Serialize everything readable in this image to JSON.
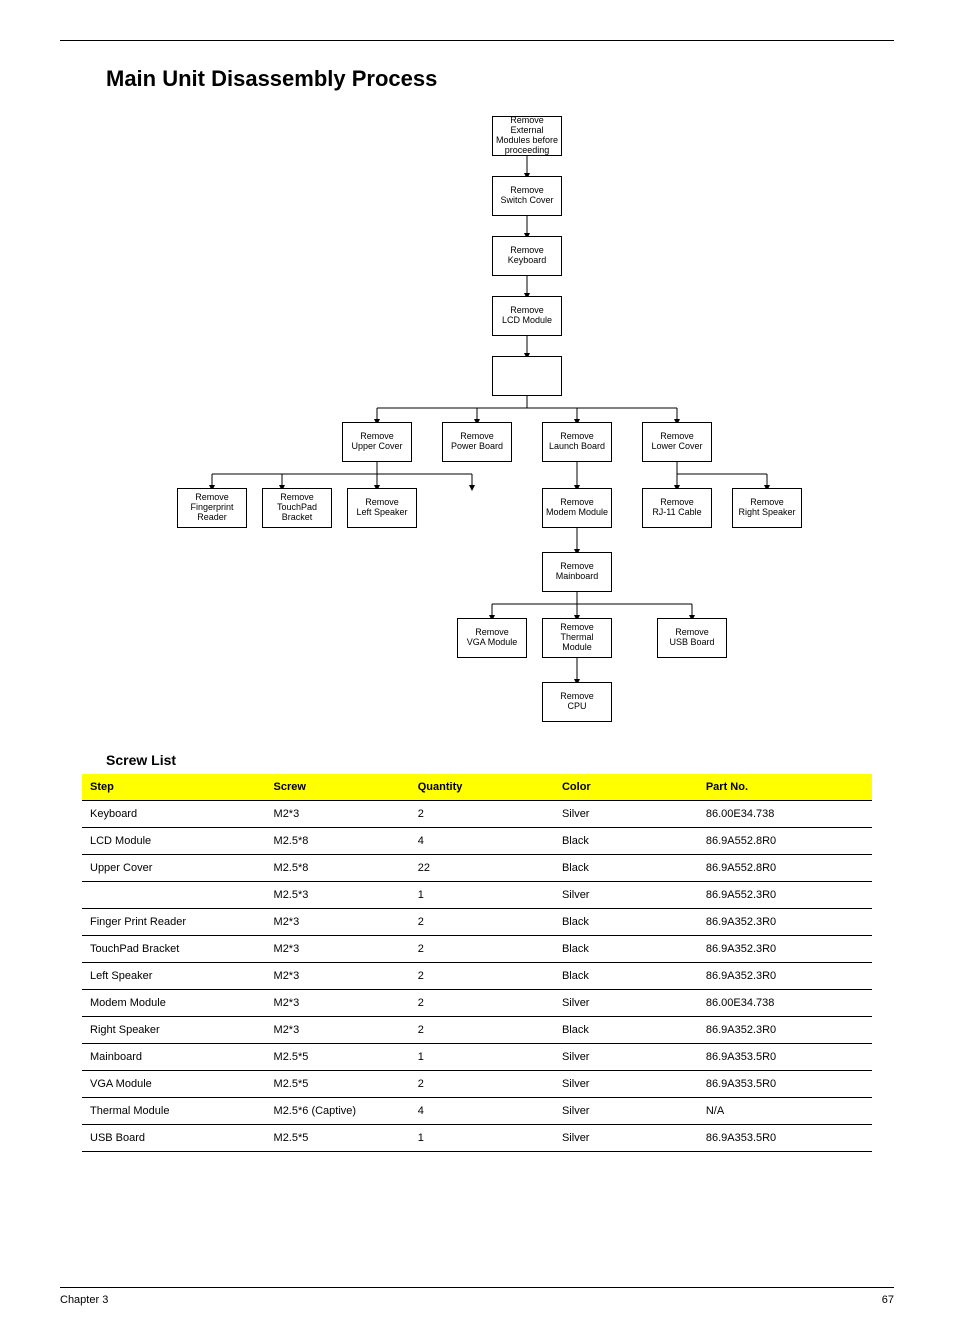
{
  "section_title": "Main Unit Disassembly Process",
  "diagram": {
    "b1": "Remove External\nModules before\nproceeding",
    "b2": "Remove\nSwitch Cover",
    "b3": "Remove\nKeyboard",
    "b4": "Remove\nLCD Module",
    "b5": "Remove\nUpper Cover",
    "b6": "Remove\nPower Board",
    "b7": "Remove\nLaunch Board",
    "b8": "Remove\nLower Cover",
    "b9": "Remove\nFingerprint\nReader",
    "b10": "Remove\nTouchPad\nBracket",
    "b11": "Remove\nLeft Speaker",
    "b12": "Remove\nModem Module",
    "b13": "Remove\nRJ-11 Cable",
    "b14": "Remove\nRight Speaker",
    "b15": "Remove\nMainboard",
    "b16": "Remove\nVGA Module",
    "b17": "Remove\nThermal Module",
    "b18": "Remove\nUSB Board",
    "b19": "Remove\nCPU"
  },
  "screw_title": "Screw List",
  "table": {
    "headers": [
      "Step",
      "Screw",
      "Quantity",
      "Color",
      "Part No."
    ],
    "rows": [
      {
        "c1": "Keyboard",
        "c2": "M2*3",
        "c3": "2",
        "c4": "Silver",
        "c5": "86.00E34.738"
      },
      {
        "c1": "LCD Module",
        "c2": "M2.5*8",
        "c3": "4",
        "c4": "Black",
        "c5": "86.9A552.8R0"
      },
      {
        "c1": "Upper Cover",
        "c2": "M2.5*8",
        "c3": "22",
        "c4": "Black",
        "c5": "86.9A552.8R0"
      },
      {
        "c1": "",
        "c2": "M2.5*3",
        "c3": "1",
        "c4": "Silver",
        "c5": "86.9A552.3R0"
      },
      {
        "c1": "Finger Print Reader",
        "c2": "M2*3",
        "c3": "2",
        "c4": "Black",
        "c5": "86.9A352.3R0"
      },
      {
        "c1": "TouchPad Bracket",
        "c2": "M2*3",
        "c3": "2",
        "c4": "Black",
        "c5": "86.9A352.3R0"
      },
      {
        "c1": "Left Speaker",
        "c2": "M2*3",
        "c3": "2",
        "c4": "Black",
        "c5": "86.9A352.3R0"
      },
      {
        "c1": "Modem Module",
        "c2": "M2*3",
        "c3": "2",
        "c4": "Silver",
        "c5": "86.00E34.738"
      },
      {
        "c1": "Right Speaker",
        "c2": "M2*3",
        "c3": "2",
        "c4": "Black",
        "c5": "86.9A352.3R0"
      },
      {
        "c1": "Mainboard",
        "c2": "M2.5*5",
        "c3": "1",
        "c4": "Silver",
        "c5": "86.9A353.5R0"
      },
      {
        "c1": "VGA Module",
        "c2": "M2.5*5",
        "c3": "2",
        "c4": "Silver",
        "c5": "86.9A353.5R0"
      },
      {
        "c1": "Thermal Module",
        "c2": "M2.5*6 (Captive)",
        "c3": "4",
        "c4": "Silver",
        "c5": "N/A"
      },
      {
        "c1": "USB Board",
        "c2": "M2.5*5",
        "c3": "1",
        "c4": "Silver",
        "c5": "86.9A353.5R0"
      }
    ]
  },
  "footer": {
    "left": "Chapter 3",
    "right": "67"
  }
}
